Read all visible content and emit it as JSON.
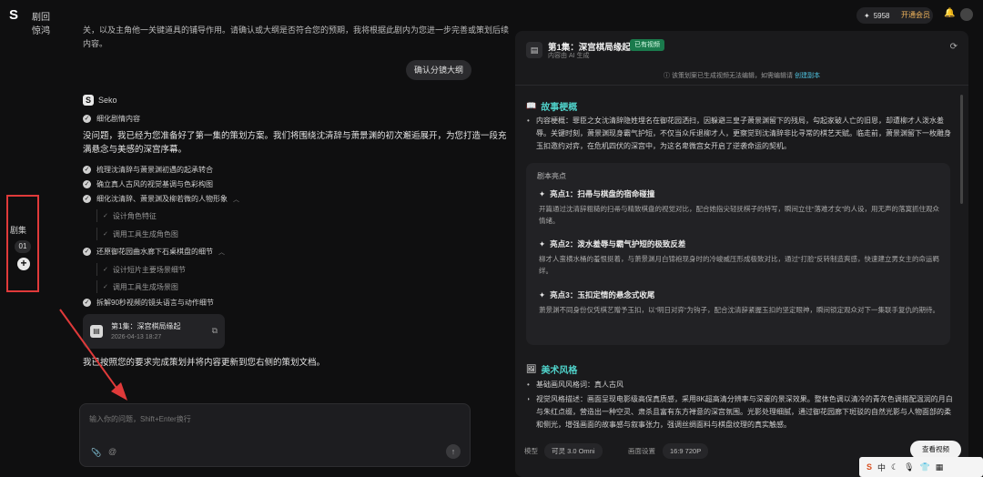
{
  "app": {
    "title": "剧回惊鸿"
  },
  "topbar": {
    "credits": "5958",
    "member_label": "开通会员"
  },
  "sidebar": {
    "episodes_label": "剧集",
    "episode_number": "01"
  },
  "chat": {
    "top_text": "关，以及主角他一关键道具的铺导作用。请确认或大纲是否符合您的预期，我将根据此剧内为您进一步完善或策划后续内容。",
    "user_message": "确认分镜大纲",
    "assistant_name": "Seko",
    "steps_top": "细化剧情内容",
    "paragraph": "没问题，我已经为您准备好了第一集的策划方案。我们将围绕沈清辞与萧景渊的初次邂逅展开，为您打造一段充满悬念与美感的深宫序幕。",
    "steps": [
      {
        "label": "梳理沈清辞与萧景渊初遇的起承转合"
      },
      {
        "label": "确立真人古风的视觉基调与色彩构图"
      },
      {
        "label": "细化沈清辞、萧景渊及柳若微的人物形象"
      },
      {
        "label": "还原御花园曲水廊下石桌棋盘的细节"
      },
      {
        "label": "拆解90秒视频的镜头语言与动作细节"
      }
    ],
    "substeps_a": [
      "设计角色特征",
      "调用工具生成角色图"
    ],
    "substeps_b": [
      "设计短片主要场景细节",
      "调用工具生成场景图"
    ],
    "doc_card": {
      "title": "第1集：深宫棋局缘起",
      "date": "2026-04-13 18:27"
    },
    "final_text": "我已按照您的要求完成策划并将内容更新到您右侧的策划文档。",
    "input": {
      "placeholder": "输入你的问题，Shift+Enter换行"
    }
  },
  "panel": {
    "title": "第1集：深宫棋局缘起",
    "badge": "已有视频",
    "subtitle": "内容由 AI 生成",
    "notice": "该策划案已生成视频无法编辑，如需编辑请",
    "notice_link": "创建副本",
    "story_section": "故事梗概",
    "story_bullet": "内容梗概：罪臣之女沈清辞隐姓埋名在御花园洒扫，因躲避三皇子萧景渊留下的残局，勾起家破人亡的旧恩，却遭柳才人泼水羞辱。关键时刻，萧景渊现身霸气护短，不仅当众斥退柳才人，更察觉到沈清辞非比寻常的棋艺天赋。临走前，萧景渊留下一枚雕身玉扣邀约对弈，在危机四伏的深宫中，为这名卑微宫女开启了逆袭命运的契机。",
    "highlights_head": "剧本亮点",
    "highlights": [
      {
        "title": "亮点1：扫帚与棋盘的宿命碰撞",
        "desc": "开篇通过沈清辞粗糙的扫帚与精致棋盘的视觉对比，配合她指尖轻抚棋子的特写，瞬间立住“落难才女”的人设，用无声的落寞抓住观众情绪。"
      },
      {
        "title": "亮点2：泼水羞辱与霸气护短的极致反差",
        "desc": "柳才人蛮横水桶的羞恨挺着，与萧景渊月白锦袍现身时的冷峻威压形成极致对比，通过“打脸”反转制造爽感，快速建立男女主的命运羁绊。"
      },
      {
        "title": "亮点3：玉扣定情的悬念式收尾",
        "desc": "萧景渊不同身份仅凭棋艺赠予玉扣，以“明日对弈”为钩子，配合沈清辞紧握玉扣的坚定眼神，瞬间锁定观众对下一集联手复仇的期待。"
      }
    ],
    "art_section": "美术风格",
    "art_bullet_1": "基础画风风格词：真人古风",
    "art_bullet_2": "视觉风格描述：画面呈现电影级高保真质感，采用8K超高清分辨率与深邃的景深效果。整体色调以清冷的青灰色调搭配温润的月白与朱红点缀，营造出一种空灵、肃杀且富有东方禅意的深宫氛围。光影处理细腻，通过御花园廊下斑驳的自然光影与人物面部的柔和侧光，增强画面的故事感与叙事张力，强调丝绸面料与棋盘纹理的真实触感。",
    "bottom": {
      "model_label": "模型",
      "model_value": "可灵 3.0 Omni",
      "settings_label": "画面设置",
      "settings_value": "16:9 720P",
      "view_button": "查看视频"
    }
  },
  "taskbar": {
    "ime": "中"
  },
  "colors": {
    "accent": "#4fd0c8",
    "badge": "#1a7a4c",
    "highlight_box": "#e03a3a"
  }
}
